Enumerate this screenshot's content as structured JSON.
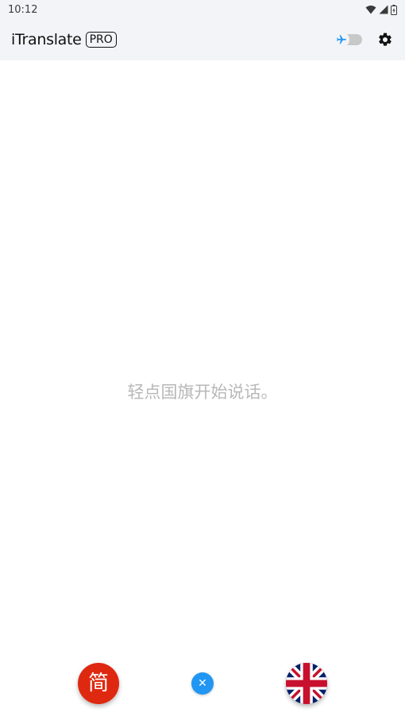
{
  "status_bar": {
    "time": "10:12",
    "icons": [
      "wifi-icon",
      "signal-icon",
      "battery-icon"
    ]
  },
  "app_bar": {
    "brand_name": "iTranslate",
    "brand_badge": "PRO",
    "actions": [
      "offline-mode-toggle",
      "settings-gear-icon"
    ]
  },
  "main": {
    "hint": "轻点国旗开始说话。"
  },
  "bottom_controls": {
    "source_language_glyph": "简",
    "source_language_color": "#de2910",
    "target_language_flag": "uk-flag-icon",
    "swap_glyph": "✕",
    "swap_color": "#2196f3"
  }
}
